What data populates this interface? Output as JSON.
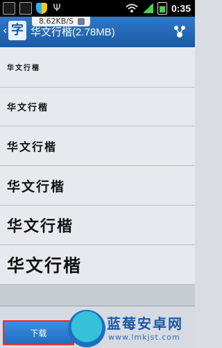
{
  "status_bar": {
    "time": "0:35",
    "usb_symbol": "Ψ",
    "icons": [
      "notification-icon",
      "notification-icon",
      "shield-icon",
      "usb-icon",
      "wifi-icon",
      "signal-icon",
      "battery-icon"
    ]
  },
  "title_bar": {
    "back_symbol": "‹",
    "logo_text": "字",
    "title": "华文行楷(2.78MB)",
    "speed": "8.62KB/S"
  },
  "previews": [
    {
      "text": "华文行楷",
      "font_px": 10
    },
    {
      "text": "华文行楷",
      "font_px": 13
    },
    {
      "text": "华文行楷",
      "font_px": 16
    },
    {
      "text": "华文行楷",
      "font_px": 19
    },
    {
      "text": "华文行楷",
      "font_px": 22
    },
    {
      "text": "华文行楷",
      "font_px": 25
    }
  ],
  "bottom_bar": {
    "download_label": "下载"
  },
  "watermark": {
    "title": "蓝莓安卓网",
    "url": "www.lmkjst.com"
  },
  "colors": {
    "title_bar": "#1a5aa3",
    "download_border": "#e23333"
  }
}
